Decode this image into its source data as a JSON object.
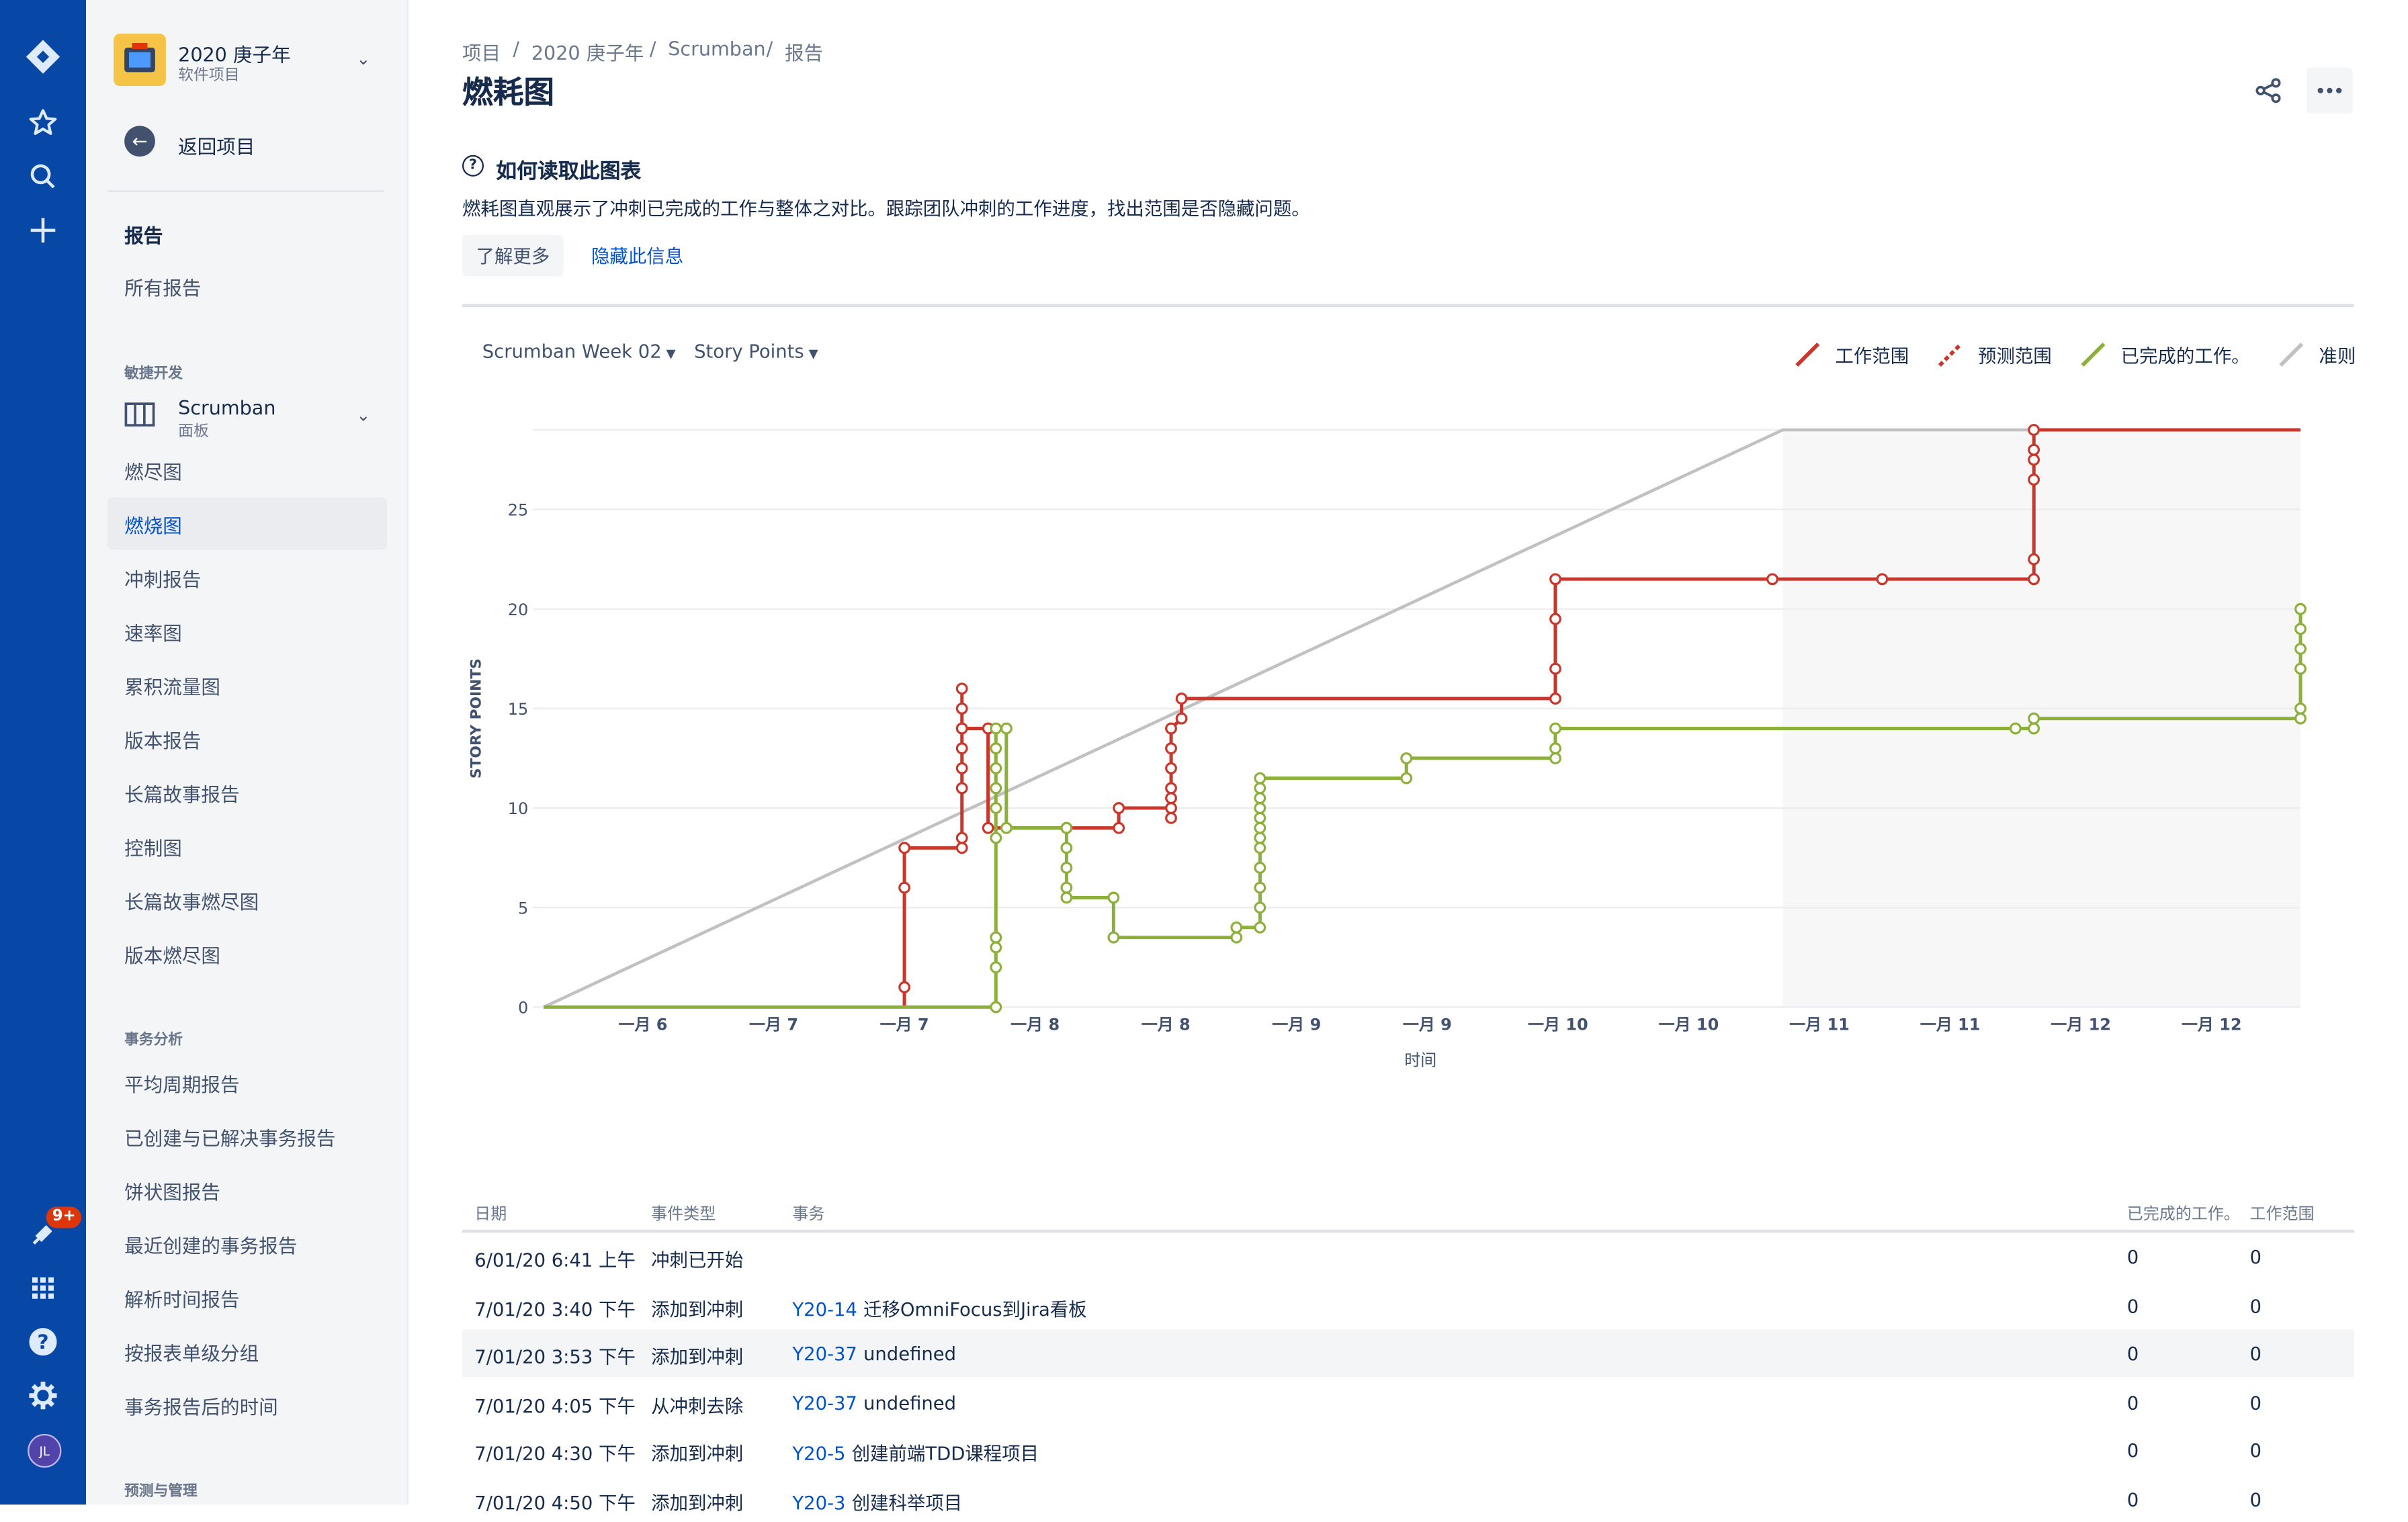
{
  "sidebar": {
    "project_name": "2020 庚子年",
    "project_type": "软件项目",
    "back_label": "返回项目",
    "reports_heading": "报告",
    "all_reports": "所有报告",
    "agile_section": "敏捷开发",
    "board_name": "Scrumban",
    "board_type": "面板",
    "agile_items": [
      {
        "label": "燃尽图",
        "active": false
      },
      {
        "label": "燃烧图",
        "active": true
      },
      {
        "label": "冲刺报告",
        "active": false
      },
      {
        "label": "速率图",
        "active": false
      },
      {
        "label": "累积流量图",
        "active": false
      },
      {
        "label": "版本报告",
        "active": false
      },
      {
        "label": "长篇故事报告",
        "active": false
      },
      {
        "label": "控制图",
        "active": false
      },
      {
        "label": "长篇故事燃尽图",
        "active": false
      },
      {
        "label": "版本燃尽图",
        "active": false
      }
    ],
    "issue_section": "事务分析",
    "issue_items": [
      {
        "label": "平均周期报告"
      },
      {
        "label": "已创建与已解决事务报告"
      },
      {
        "label": "饼状图报告"
      },
      {
        "label": "最近创建的事务报告"
      },
      {
        "label": "解析时间报告"
      },
      {
        "label": "按报表单级分组"
      },
      {
        "label": "事务报告后的时间"
      }
    ],
    "forecast_section": "预测与管理"
  },
  "global_nav": {
    "notification_badge": "9+",
    "user_initials": "JL",
    "icons": [
      "jira-logo-icon",
      "star-icon",
      "search-icon",
      "plus-icon",
      "notification-icon",
      "apps-icon",
      "help-icon",
      "settings-icon"
    ]
  },
  "breadcrumb": [
    "项目",
    "2020 庚子年",
    "Scrumban",
    "报告"
  ],
  "page_title": "燃耗图",
  "info": {
    "title": "如何读取此图表",
    "description": "燃耗图直观展示了冲刺已完成的工作与整体之对比。跟踪团队冲刺的工作进度，找出范围是否隐藏问题。",
    "learn_more": "了解更多",
    "hide": "隐藏此信息"
  },
  "controls": {
    "sprint": "Scrumban Week 02",
    "estimate": "Story Points"
  },
  "colors": {
    "scope": "#c9372c",
    "completed": "#8db03c",
    "guideline": "#c1c1c1",
    "nav": "#0747a6",
    "link": "#0052cc"
  },
  "chart_data": {
    "type": "line",
    "title": "",
    "xlabel": "时间",
    "ylabel": "STORY POINTS",
    "ylim": [
      0,
      29
    ],
    "yticks": [
      0,
      5,
      10,
      15,
      20,
      25
    ],
    "xlim": [
      5.6,
      12.32
    ],
    "x_ticks": [
      {
        "x": 5.98,
        "label": "一月 6"
      },
      {
        "x": 6.48,
        "label": "一月 7"
      },
      {
        "x": 6.98,
        "label": "一月 7"
      },
      {
        "x": 7.48,
        "label": "一月 8"
      },
      {
        "x": 7.98,
        "label": "一月 8"
      },
      {
        "x": 8.48,
        "label": "一月 9"
      },
      {
        "x": 8.98,
        "label": "一月 9"
      },
      {
        "x": 9.48,
        "label": "一月 10"
      },
      {
        "x": 9.98,
        "label": "一月 10"
      },
      {
        "x": 10.48,
        "label": "一月 11"
      },
      {
        "x": 10.98,
        "label": "一月 11"
      },
      {
        "x": 11.48,
        "label": "一月 12"
      },
      {
        "x": 11.98,
        "label": "一月 12"
      }
    ],
    "non_working_range": [
      10.34,
      12.32
    ],
    "legend": [
      {
        "name": "工作范围",
        "style": "solid",
        "color": "#c9372c"
      },
      {
        "name": "预测范围",
        "style": "dashed",
        "color": "#c9372c"
      },
      {
        "name": "已完成的工作。",
        "style": "solid",
        "color": "#8db03c"
      },
      {
        "name": "准则",
        "style": "solid",
        "color": "#c1c1c1"
      }
    ],
    "series": [
      {
        "name": "准则",
        "color": "#c1c1c1",
        "points": [
          [
            5.6,
            0
          ],
          [
            10.34,
            29
          ],
          [
            12.32,
            29
          ]
        ]
      },
      {
        "name": "工作范围",
        "color": "#c9372c",
        "points": [
          [
            6.98,
            0
          ],
          [
            6.98,
            1
          ],
          [
            6.98,
            6
          ],
          [
            6.98,
            8
          ],
          [
            7.2,
            8
          ],
          [
            7.2,
            8.5
          ],
          [
            7.2,
            11
          ],
          [
            7.2,
            12
          ],
          [
            7.2,
            13
          ],
          [
            7.2,
            14
          ],
          [
            7.2,
            15
          ],
          [
            7.2,
            16
          ],
          [
            7.2,
            14
          ],
          [
            7.3,
            14
          ],
          [
            7.3,
            9
          ],
          [
            7.6,
            9
          ],
          [
            7.8,
            9
          ],
          [
            7.8,
            10
          ],
          [
            8.0,
            10
          ],
          [
            8.0,
            9.5
          ],
          [
            8.0,
            10.5
          ],
          [
            8.0,
            11
          ],
          [
            8.0,
            12
          ],
          [
            8.0,
            13
          ],
          [
            8.0,
            14
          ],
          [
            8.04,
            14.5
          ],
          [
            8.04,
            15.5
          ],
          [
            9.47,
            15.5
          ],
          [
            9.47,
            17
          ],
          [
            9.47,
            19.5
          ],
          [
            9.47,
            21.5
          ],
          [
            10.3,
            21.5
          ],
          [
            10.72,
            21.5
          ],
          [
            11.3,
            21.5
          ],
          [
            11.3,
            22.5
          ],
          [
            11.3,
            26.5
          ],
          [
            11.3,
            27.5
          ],
          [
            11.3,
            28
          ],
          [
            11.3,
            29
          ],
          [
            12.32,
            29
          ]
        ]
      },
      {
        "name": "已完成的工作。",
        "color": "#8db03c",
        "points": [
          [
            5.6,
            0
          ],
          [
            7.33,
            0
          ],
          [
            7.33,
            2
          ],
          [
            7.33,
            3
          ],
          [
            7.33,
            3.5
          ],
          [
            7.33,
            8.5
          ],
          [
            7.33,
            10
          ],
          [
            7.33,
            11
          ],
          [
            7.33,
            12
          ],
          [
            7.33,
            13
          ],
          [
            7.33,
            14
          ],
          [
            7.37,
            14
          ],
          [
            7.37,
            9
          ],
          [
            7.6,
            9
          ],
          [
            7.6,
            8
          ],
          [
            7.6,
            7
          ],
          [
            7.6,
            6
          ],
          [
            7.6,
            5.5
          ],
          [
            7.78,
            5.5
          ],
          [
            7.78,
            3.5
          ],
          [
            8.25,
            3.5
          ],
          [
            8.25,
            4
          ],
          [
            8.34,
            4
          ],
          [
            8.34,
            5
          ],
          [
            8.34,
            6
          ],
          [
            8.34,
            7
          ],
          [
            8.34,
            8
          ],
          [
            8.34,
            8.5
          ],
          [
            8.34,
            9
          ],
          [
            8.34,
            9.5
          ],
          [
            8.34,
            10
          ],
          [
            8.34,
            10.5
          ],
          [
            8.34,
            11
          ],
          [
            8.34,
            11.5
          ],
          [
            8.9,
            11.5
          ],
          [
            8.9,
            12.5
          ],
          [
            9.47,
            12.5
          ],
          [
            9.47,
            13
          ],
          [
            9.47,
            14
          ],
          [
            11.23,
            14
          ],
          [
            11.3,
            14
          ],
          [
            11.3,
            14.5
          ],
          [
            12.32,
            14.5
          ],
          [
            12.32,
            15
          ],
          [
            12.32,
            17
          ],
          [
            12.32,
            18
          ],
          [
            12.32,
            19
          ],
          [
            12.32,
            20
          ]
        ]
      }
    ]
  },
  "table": {
    "headers": [
      "日期",
      "事件类型",
      "事务",
      "已完成的工作。",
      "工作范围"
    ],
    "rows": [
      {
        "date": "6/01/20 6:41 上午",
        "event": "冲刺已开始",
        "key": "",
        "summary": "",
        "completed": "0",
        "scope": "0"
      },
      {
        "date": "7/01/20 3:40 下午",
        "event": "添加到冲刺",
        "key": "Y20-14",
        "summary": "迁移OmniFocus到Jira看板",
        "completed": "0",
        "scope": "0"
      },
      {
        "date": "7/01/20 3:53 下午",
        "event": "添加到冲刺",
        "key": "Y20-37",
        "summary": "undefined",
        "completed": "0",
        "scope": "0"
      },
      {
        "date": "7/01/20 4:05 下午",
        "event": "从冲刺去除",
        "key": "Y20-37",
        "summary": "undefined",
        "completed": "0",
        "scope": "0"
      },
      {
        "date": "7/01/20 4:30 下午",
        "event": "添加到冲刺",
        "key": "Y20-5",
        "summary": "创建前端TDD课程项目",
        "completed": "0",
        "scope": "0"
      },
      {
        "date": "7/01/20 4:50 下午",
        "event": "添加到冲刺",
        "key": "Y20-3",
        "summary": "创建科举项目",
        "completed": "0",
        "scope": "0"
      }
    ]
  }
}
